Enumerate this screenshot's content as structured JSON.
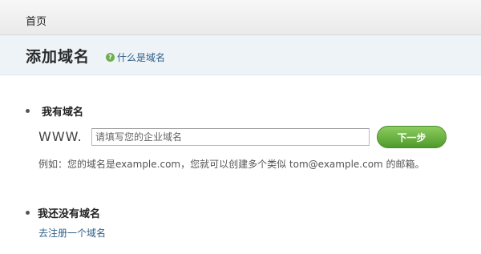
{
  "nav": {
    "home_label": "首页"
  },
  "header": {
    "title": "添加域名",
    "help_link": "什么是域名",
    "help_icon": "question-circle-icon"
  },
  "have_domain": {
    "title": "我有域名",
    "prefix": "WWW.",
    "input_placeholder": "请填写您的企业域名",
    "input_value": "",
    "next_button": "下一步",
    "hint": "例如：您的域名是example.com，您就可以创建多个类似 tom@example.com 的邮箱。"
  },
  "no_domain": {
    "title": "我还没有域名",
    "register_link": "去注册一个域名"
  },
  "colors": {
    "accent_green": "#5aa63a",
    "link_blue": "#2e5f86",
    "header_bg": "#eef3f7"
  }
}
